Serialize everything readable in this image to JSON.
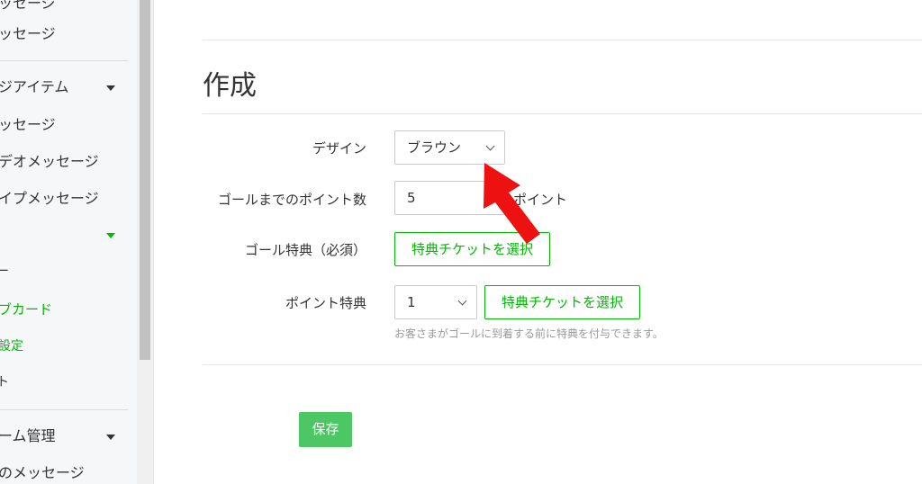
{
  "sidebar": {
    "items": [
      {
        "label": "ッセージ",
        "style": "plain"
      },
      {
        "label": "ッセージ",
        "style": "plain"
      },
      {
        "label": "ジアイテム",
        "style": "group"
      },
      {
        "label": "ッセージ",
        "style": "plain"
      },
      {
        "label": "デオメッセージ",
        "style": "plain"
      },
      {
        "label": "イプメッセージ",
        "style": "plain"
      },
      {
        "label": "ブカード",
        "style": "green"
      },
      {
        "label": "設定",
        "style": "green"
      },
      {
        "label": "ーム管理",
        "style": "group"
      },
      {
        "label": "のメッセージ",
        "style": "plain"
      }
    ]
  },
  "main": {
    "title": "作成",
    "form": {
      "design": {
        "label": "デザイン",
        "value": "ブラウン"
      },
      "goal_points": {
        "label": "ゴールまでのポイント数",
        "value": "5",
        "suffix": "ポイント"
      },
      "goal_reward": {
        "label": "ゴール特典（必須）",
        "button": "特典チケットを選択"
      },
      "point_reward": {
        "label": "ポイント特典",
        "value": "1",
        "button": "特典チケットを選択",
        "help": "お客さまがゴールに到着する前に特典を付与できます。"
      }
    },
    "save_label": "保存"
  },
  "colors": {
    "accent": "#00b900",
    "save": "#4cc764",
    "arrow": "#ee1111"
  }
}
